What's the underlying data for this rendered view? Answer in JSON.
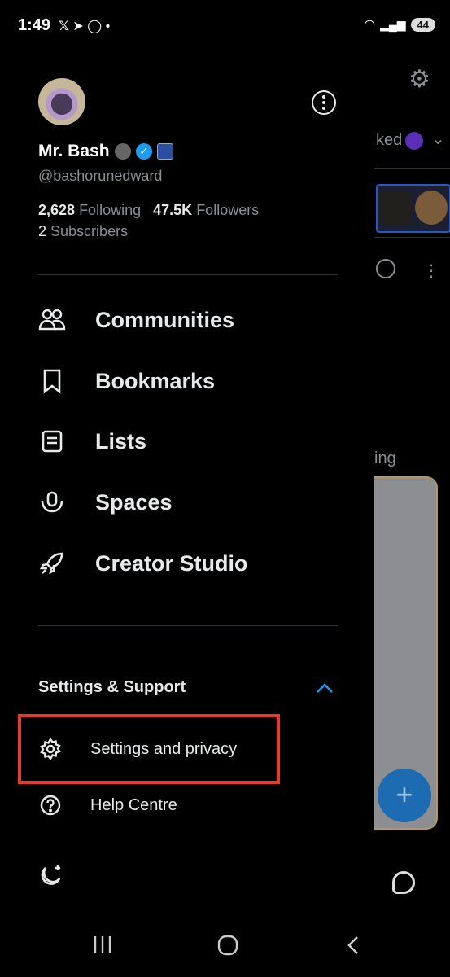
{
  "status_bar": {
    "time": "1:49",
    "notif_icons": [
      "x-icon",
      "telegram-icon",
      "whatsapp-icon",
      "dot-icon"
    ],
    "signal": "5",
    "battery": "44"
  },
  "profile": {
    "display_name": "Mr. Bash",
    "handle": "@bashorunedward",
    "following_count": "2,628",
    "following_label": "Following",
    "followers_count": "47.5K",
    "followers_label": "Followers",
    "subscribers_count": "2",
    "subscribers_label": "Subscribers"
  },
  "nav": {
    "items": [
      {
        "label": "Communities",
        "icon": "communities-icon"
      },
      {
        "label": "Bookmarks",
        "icon": "bookmark-icon"
      },
      {
        "label": "Lists",
        "icon": "list-icon"
      },
      {
        "label": "Spaces",
        "icon": "spaces-icon"
      },
      {
        "label": "Creator Studio",
        "icon": "rocket-icon"
      }
    ]
  },
  "settings_section": {
    "title": "Settings & Support",
    "items": [
      {
        "label": "Settings and privacy",
        "icon": "gear-icon"
      },
      {
        "label": "Help Centre",
        "icon": "help-icon"
      }
    ]
  },
  "background": {
    "tab_fragment": "ked",
    "text_fragment": "ing"
  },
  "colors": {
    "background": "#000000",
    "text": "#e7e9ea",
    "muted": "#8b8f93",
    "accent": "#1d9bf0",
    "highlight": "#e53b2c"
  }
}
